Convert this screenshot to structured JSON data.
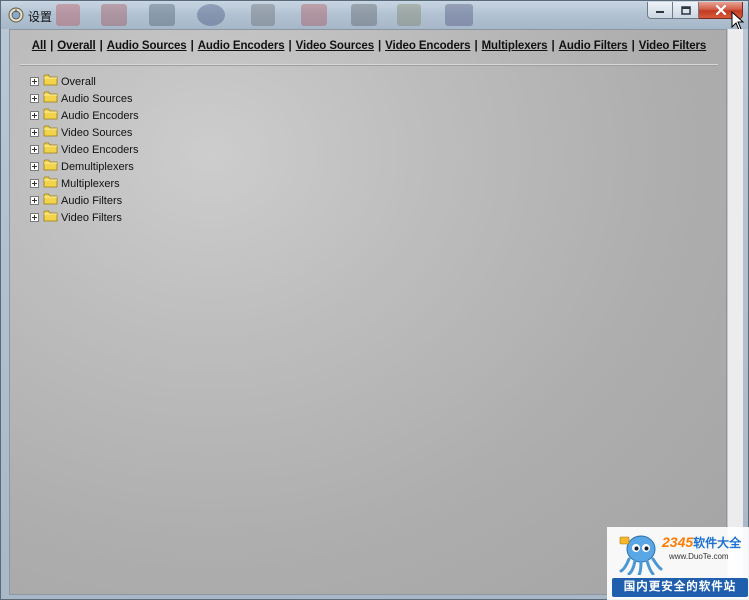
{
  "window": {
    "title": "设置"
  },
  "navbar": {
    "links": [
      "All",
      "Overall",
      "Audio Sources",
      "Audio Encoders",
      "Video Sources",
      "Video Encoders",
      "Multiplexers",
      "Audio Filters",
      "Video Filters"
    ],
    "separator": "|"
  },
  "tree": {
    "items": [
      "Overall",
      "Audio Sources",
      "Audio Encoders",
      "Video Sources",
      "Video Encoders",
      "Demultiplexers",
      "Multiplexers",
      "Audio Filters",
      "Video Filters"
    ]
  },
  "watermark": {
    "brand_num": "2345",
    "brand_text": "软件大全",
    "url": "www.DuoTe.com",
    "slogan": "国内更安全的软件站"
  },
  "colors": {
    "close_button": "#c23a22",
    "folder": "#f2d44c",
    "watermark_blue": "#1f5fae"
  }
}
